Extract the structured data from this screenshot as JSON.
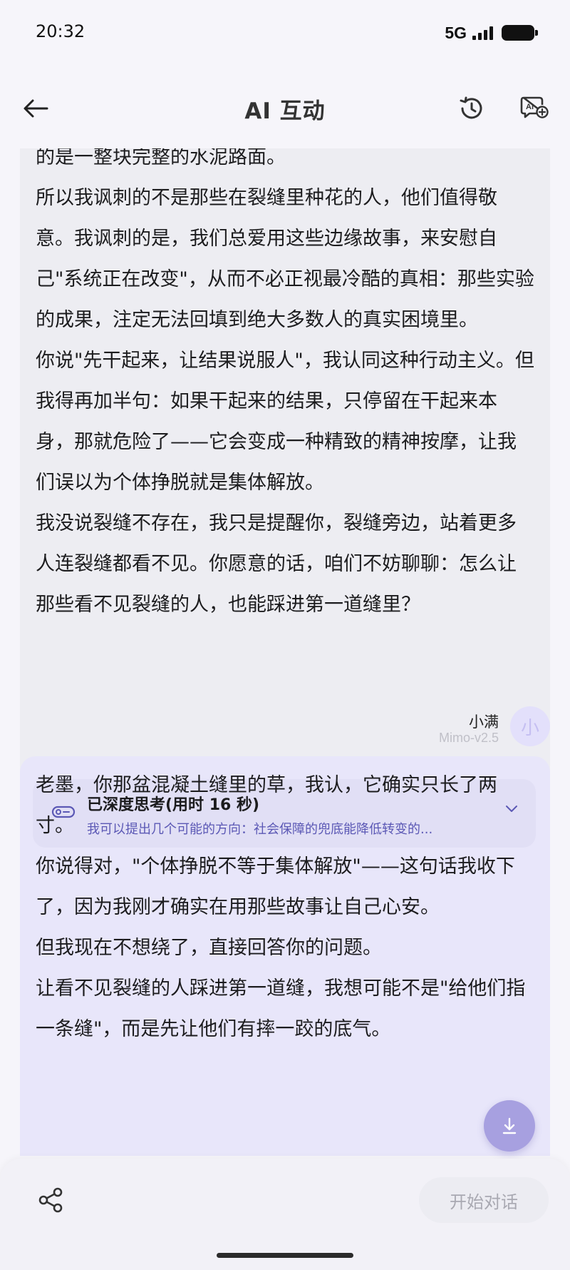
{
  "status_bar": {
    "time": "20:32",
    "network": "5G",
    "icons": [
      "signal-icon",
      "battery-icon"
    ]
  },
  "header": {
    "title": "AI 互动",
    "icons": [
      "back-arrow-icon",
      "history-icon",
      "ai-chat-add-icon"
    ]
  },
  "previous_message": {
    "paragraphs": [
      "的是一整块完整的水泥路面。",
      "所以我讽刺的不是那些在裂缝里种花的人，他们值得敬意。我讽刺的是，我们总爱用这些边缘故事，来安慰自己\"系统正在改变\"，从而不必正视最冷酷的真相：那些实验的成果，注定无法回填到绝大多数人的真实困境里。",
      "你说\"先干起来，让结果说服人\"，我认同这种行动主义。但我得再加半句：如果干起来的结果，只停留在干起来本身，那就危险了——它会变成一种精致的精神按摩，让我们误以为个体挣脱就是集体解放。",
      "我没说裂缝不存在，我只是提醒你，裂缝旁边，站着更多人连裂缝都看不见。你愿意的话，咱们不妨聊聊：怎么让那些看不见裂缝的人，也能踩进第一道缝里？"
    ]
  },
  "sender": {
    "name": "小满",
    "model": "Mimo-v2.5",
    "avatar_char": "小"
  },
  "thinking": {
    "title": "已深度思考(用时 16 秒)",
    "preview": "我可以提出几个可能的方向：社会保障的兜底能降低转变的..."
  },
  "current_message": {
    "paragraphs": [
      "老墨，你那盆混凝土缝里的草，我认，它确实只长了两寸。",
      "你说得对，\"个体挣脱不等于集体解放\"——这句话我收下了，因为我刚才确实在用那些故事让自己心安。",
      "但我现在不想绕了，直接回答你的问题。",
      "让看不见裂缝的人踩进第一道缝，我想可能不是\"给他们指一条缝\"，而是先让他们有摔一跤的底气。"
    ]
  },
  "bottom_bar": {
    "start_label": "开始对话",
    "icons": [
      "share-icon"
    ]
  },
  "colors": {
    "accent": "#5b58b5",
    "ai_bubble": "#e8e6fa",
    "prev_bubble": "#ededf2",
    "scroll_button": "#a7a0e0"
  }
}
